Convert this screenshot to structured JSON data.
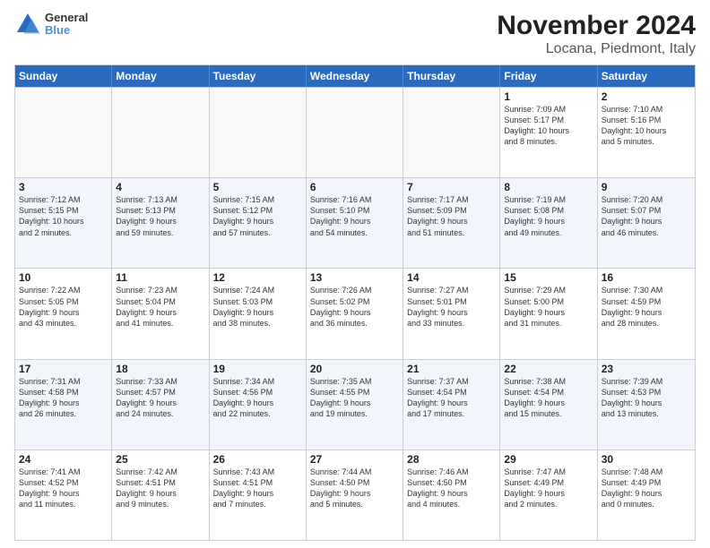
{
  "logo": {
    "line1": "General",
    "line2": "Blue"
  },
  "title": "November 2024",
  "subtitle": "Locana, Piedmont, Italy",
  "headers": [
    "Sunday",
    "Monday",
    "Tuesday",
    "Wednesday",
    "Thursday",
    "Friday",
    "Saturday"
  ],
  "weeks": [
    [
      {
        "day": "",
        "info": ""
      },
      {
        "day": "",
        "info": ""
      },
      {
        "day": "",
        "info": ""
      },
      {
        "day": "",
        "info": ""
      },
      {
        "day": "",
        "info": ""
      },
      {
        "day": "1",
        "info": "Sunrise: 7:09 AM\nSunset: 5:17 PM\nDaylight: 10 hours\nand 8 minutes."
      },
      {
        "day": "2",
        "info": "Sunrise: 7:10 AM\nSunset: 5:16 PM\nDaylight: 10 hours\nand 5 minutes."
      }
    ],
    [
      {
        "day": "3",
        "info": "Sunrise: 7:12 AM\nSunset: 5:15 PM\nDaylight: 10 hours\nand 2 minutes."
      },
      {
        "day": "4",
        "info": "Sunrise: 7:13 AM\nSunset: 5:13 PM\nDaylight: 9 hours\nand 59 minutes."
      },
      {
        "day": "5",
        "info": "Sunrise: 7:15 AM\nSunset: 5:12 PM\nDaylight: 9 hours\nand 57 minutes."
      },
      {
        "day": "6",
        "info": "Sunrise: 7:16 AM\nSunset: 5:10 PM\nDaylight: 9 hours\nand 54 minutes."
      },
      {
        "day": "7",
        "info": "Sunrise: 7:17 AM\nSunset: 5:09 PM\nDaylight: 9 hours\nand 51 minutes."
      },
      {
        "day": "8",
        "info": "Sunrise: 7:19 AM\nSunset: 5:08 PM\nDaylight: 9 hours\nand 49 minutes."
      },
      {
        "day": "9",
        "info": "Sunrise: 7:20 AM\nSunset: 5:07 PM\nDaylight: 9 hours\nand 46 minutes."
      }
    ],
    [
      {
        "day": "10",
        "info": "Sunrise: 7:22 AM\nSunset: 5:05 PM\nDaylight: 9 hours\nand 43 minutes."
      },
      {
        "day": "11",
        "info": "Sunrise: 7:23 AM\nSunset: 5:04 PM\nDaylight: 9 hours\nand 41 minutes."
      },
      {
        "day": "12",
        "info": "Sunrise: 7:24 AM\nSunset: 5:03 PM\nDaylight: 9 hours\nand 38 minutes."
      },
      {
        "day": "13",
        "info": "Sunrise: 7:26 AM\nSunset: 5:02 PM\nDaylight: 9 hours\nand 36 minutes."
      },
      {
        "day": "14",
        "info": "Sunrise: 7:27 AM\nSunset: 5:01 PM\nDaylight: 9 hours\nand 33 minutes."
      },
      {
        "day": "15",
        "info": "Sunrise: 7:29 AM\nSunset: 5:00 PM\nDaylight: 9 hours\nand 31 minutes."
      },
      {
        "day": "16",
        "info": "Sunrise: 7:30 AM\nSunset: 4:59 PM\nDaylight: 9 hours\nand 28 minutes."
      }
    ],
    [
      {
        "day": "17",
        "info": "Sunrise: 7:31 AM\nSunset: 4:58 PM\nDaylight: 9 hours\nand 26 minutes."
      },
      {
        "day": "18",
        "info": "Sunrise: 7:33 AM\nSunset: 4:57 PM\nDaylight: 9 hours\nand 24 minutes."
      },
      {
        "day": "19",
        "info": "Sunrise: 7:34 AM\nSunset: 4:56 PM\nDaylight: 9 hours\nand 22 minutes."
      },
      {
        "day": "20",
        "info": "Sunrise: 7:35 AM\nSunset: 4:55 PM\nDaylight: 9 hours\nand 19 minutes."
      },
      {
        "day": "21",
        "info": "Sunrise: 7:37 AM\nSunset: 4:54 PM\nDaylight: 9 hours\nand 17 minutes."
      },
      {
        "day": "22",
        "info": "Sunrise: 7:38 AM\nSunset: 4:54 PM\nDaylight: 9 hours\nand 15 minutes."
      },
      {
        "day": "23",
        "info": "Sunrise: 7:39 AM\nSunset: 4:53 PM\nDaylight: 9 hours\nand 13 minutes."
      }
    ],
    [
      {
        "day": "24",
        "info": "Sunrise: 7:41 AM\nSunset: 4:52 PM\nDaylight: 9 hours\nand 11 minutes."
      },
      {
        "day": "25",
        "info": "Sunrise: 7:42 AM\nSunset: 4:51 PM\nDaylight: 9 hours\nand 9 minutes."
      },
      {
        "day": "26",
        "info": "Sunrise: 7:43 AM\nSunset: 4:51 PM\nDaylight: 9 hours\nand 7 minutes."
      },
      {
        "day": "27",
        "info": "Sunrise: 7:44 AM\nSunset: 4:50 PM\nDaylight: 9 hours\nand 5 minutes."
      },
      {
        "day": "28",
        "info": "Sunrise: 7:46 AM\nSunset: 4:50 PM\nDaylight: 9 hours\nand 4 minutes."
      },
      {
        "day": "29",
        "info": "Sunrise: 7:47 AM\nSunset: 4:49 PM\nDaylight: 9 hours\nand 2 minutes."
      },
      {
        "day": "30",
        "info": "Sunrise: 7:48 AM\nSunset: 4:49 PM\nDaylight: 9 hours\nand 0 minutes."
      }
    ]
  ]
}
